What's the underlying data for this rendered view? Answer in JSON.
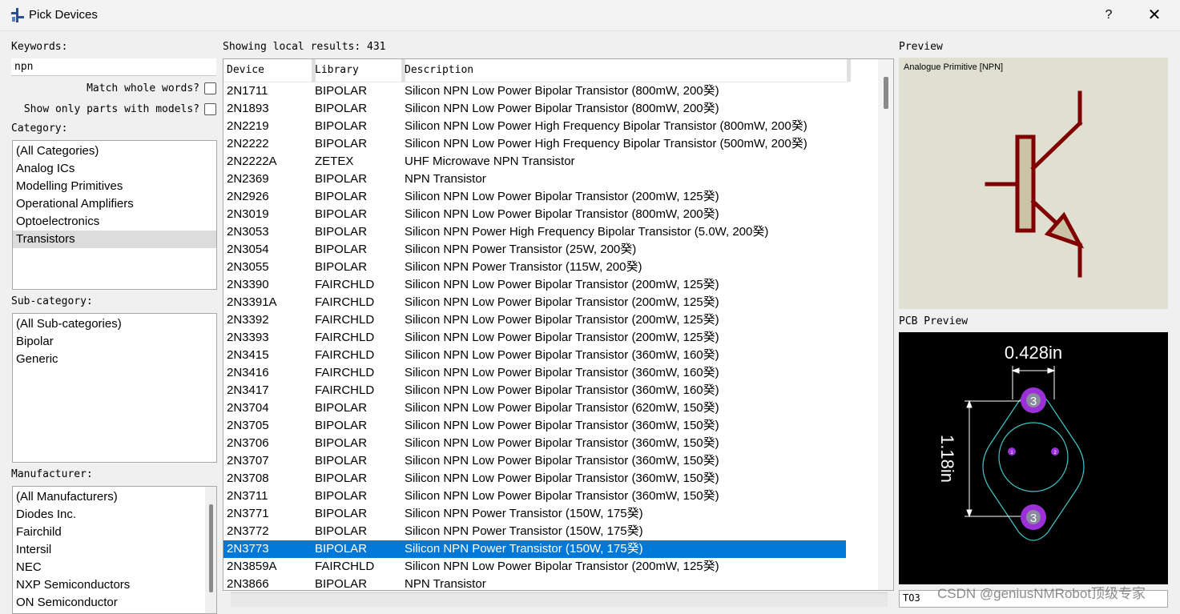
{
  "window": {
    "title": "Pick Devices",
    "help_label": "?",
    "close_label": "✕"
  },
  "left": {
    "keywords_label": "Keywords:",
    "keywords_value": "npn",
    "match_whole_words_label": "Match whole words?",
    "show_only_models_label": "Show only parts with models?",
    "category_label": "Category:",
    "categories": [
      "(All Categories)",
      "Analog ICs",
      "Modelling Primitives",
      "Operational Amplifiers",
      "Optoelectronics",
      "Transistors"
    ],
    "selected_category": "Transistors",
    "subcategory_label": "Sub-category:",
    "subcategories": [
      "(All Sub-categories)",
      "Bipolar",
      "Generic"
    ],
    "manufacturer_label": "Manufacturer:",
    "manufacturers": [
      "(All Manufacturers)",
      "Diodes Inc.",
      "Fairchild",
      "Intersil",
      "NEC",
      "NXP Semiconductors",
      "ON Semiconductor"
    ]
  },
  "results": {
    "summary": "Showing local results: 431",
    "columns": [
      "Device",
      "Library",
      "Description"
    ],
    "selected_device": "2N3773",
    "rows": [
      [
        "2N1711",
        "BIPOLAR",
        "Silicon NPN Low Power Bipolar Transistor (800mW, 200癸)"
      ],
      [
        "2N1893",
        "BIPOLAR",
        "Silicon NPN Low Power Bipolar Transistor (800mW, 200癸)"
      ],
      [
        "2N2219",
        "BIPOLAR",
        "Silicon NPN Low Power High Frequency Bipolar Transistor (800mW, 200癸)"
      ],
      [
        "2N2222",
        "BIPOLAR",
        "Silicon NPN Low Power High Frequency Bipolar Transistor (500mW, 200癸)"
      ],
      [
        "2N2222A",
        "ZETEX",
        "UHF Microwave NPN Transistor"
      ],
      [
        "2N2369",
        "BIPOLAR",
        "NPN Transistor"
      ],
      [
        "2N2926",
        "BIPOLAR",
        "Silicon NPN Low Power Bipolar Transistor (200mW, 125癸)"
      ],
      [
        "2N3019",
        "BIPOLAR",
        "Silicon NPN Low Power Bipolar Transistor (800mW, 200癸)"
      ],
      [
        "2N3053",
        "BIPOLAR",
        "Silicon NPN Power High Frequency Bipolar Transistor (5.0W, 200癸)"
      ],
      [
        "2N3054",
        "BIPOLAR",
        "Silicon NPN Power Transistor (25W, 200癸)"
      ],
      [
        "2N3055",
        "BIPOLAR",
        "Silicon NPN Power Transistor (115W, 200癸)"
      ],
      [
        "2N3390",
        "FAIRCHLD",
        "Silicon NPN Low Power Bipolar Transistor (200mW, 125癸)"
      ],
      [
        "2N3391A",
        "FAIRCHLD",
        "Silicon NPN Low Power Bipolar Transistor (200mW, 125癸)"
      ],
      [
        "2N3392",
        "FAIRCHLD",
        "Silicon NPN Low Power Bipolar Transistor (200mW, 125癸)"
      ],
      [
        "2N3393",
        "FAIRCHLD",
        "Silicon NPN Low Power Bipolar Transistor (200mW, 125癸)"
      ],
      [
        "2N3415",
        "FAIRCHLD",
        "Silicon NPN Low Power Bipolar Transistor (360mW, 160癸)"
      ],
      [
        "2N3416",
        "FAIRCHLD",
        "Silicon NPN Low Power Bipolar Transistor (360mW, 160癸)"
      ],
      [
        "2N3417",
        "FAIRCHLD",
        "Silicon NPN Low Power Bipolar Transistor (360mW, 160癸)"
      ],
      [
        "2N3704",
        "BIPOLAR",
        "Silicon NPN Low Power Bipolar Transistor (620mW, 150癸)"
      ],
      [
        "2N3705",
        "BIPOLAR",
        "Silicon NPN Low Power Bipolar Transistor (360mW, 150癸)"
      ],
      [
        "2N3706",
        "BIPOLAR",
        "Silicon NPN Low Power Bipolar Transistor (360mW, 150癸)"
      ],
      [
        "2N3707",
        "BIPOLAR",
        "Silicon NPN Low Power Bipolar Transistor (360mW, 150癸)"
      ],
      [
        "2N3708",
        "BIPOLAR",
        "Silicon NPN Low Power Bipolar Transistor (360mW, 150癸)"
      ],
      [
        "2N3711",
        "BIPOLAR",
        "Silicon NPN Low Power Bipolar Transistor (360mW, 150癸)"
      ],
      [
        "2N3771",
        "BIPOLAR",
        "Silicon NPN Power Transistor (150W, 175癸)"
      ],
      [
        "2N3772",
        "BIPOLAR",
        "Silicon NPN Power Transistor (150W, 175癸)"
      ],
      [
        "2N3773",
        "BIPOLAR",
        "Silicon NPN Power Transistor (150W, 175癸)"
      ],
      [
        "2N3859A",
        "FAIRCHLD",
        "Silicon NPN Low Power Bipolar Transistor (200mW, 125癸)"
      ],
      [
        "2N3866",
        "BIPOLAR",
        "NPN Transistor"
      ]
    ]
  },
  "preview": {
    "label": "Preview",
    "caption": "Analogue Primitive [NPN]",
    "symbol_color": "#800000"
  },
  "pcb_preview": {
    "label": "PCB Preview",
    "width_dim": "0.428in",
    "height_dim": "1.18in",
    "pad_top": "3",
    "pad_bottom": "3",
    "pin_a": "1",
    "pin_b": "2",
    "package": "TO3"
  },
  "watermark": "CSDN @geniusNMRobot顶级专家",
  "colors": {
    "selection": "#0078d7",
    "pad": "#9b30d9",
    "outline": "#3cc8c8"
  }
}
